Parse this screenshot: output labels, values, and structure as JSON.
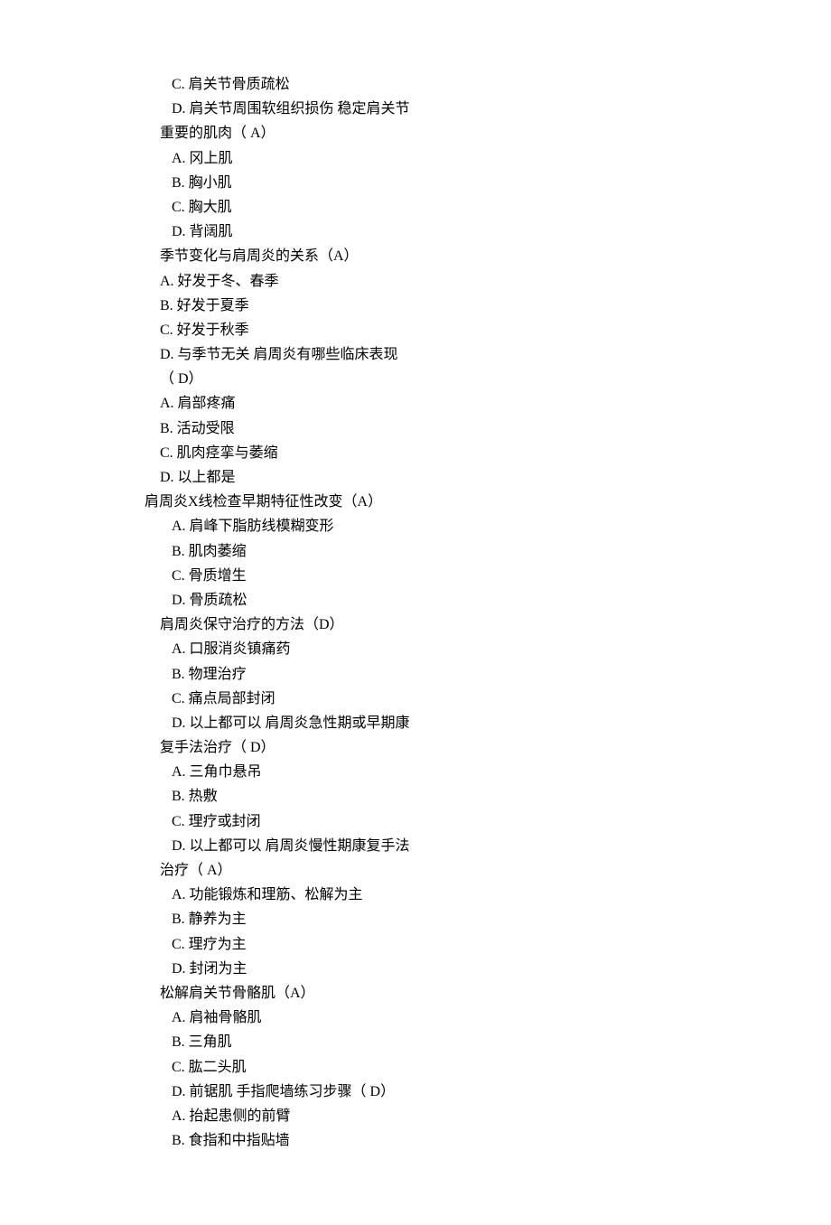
{
  "lines": [
    {
      "text": "C.  肩关节骨质疏松",
      "indent": "d4"
    },
    {
      "text": "D.  肩关节周围软组织损伤  稳定肩关节",
      "indent": "d4"
    },
    {
      "text": "重要的肌肉（ A）",
      "indent": "stem"
    },
    {
      "text": "A.  冈上肌",
      "indent": "d4"
    },
    {
      "text": "B.  胸小肌",
      "indent": "d4"
    },
    {
      "text": "C.  胸大肌",
      "indent": "d4"
    },
    {
      "text": "D.  背阔肌",
      "indent": "d4"
    },
    {
      "text": "季节变化与肩周炎的关系（A）",
      "indent": "stem"
    },
    {
      "text": "A.  好发于冬、春季",
      "indent": "opt"
    },
    {
      "text": "B.  好发于夏季",
      "indent": "opt"
    },
    {
      "text": "C.  好发于秋季",
      "indent": "opt"
    },
    {
      "text": "D.  与季节无关  肩周炎有哪些临床表现",
      "indent": "opt"
    },
    {
      "text": "（ D）",
      "indent": "stem"
    },
    {
      "text": "A.  肩部疼痛",
      "indent": "opt"
    },
    {
      "text": "B.  活动受限",
      "indent": "opt"
    },
    {
      "text": "C.  肌肉痉挛与萎缩",
      "indent": "opt"
    },
    {
      "text": "D.  以上都是",
      "indent": "opt"
    },
    {
      "text": "肩周炎X线检查早期特征性改变（A）",
      "indent": "stemL"
    },
    {
      "text": "A.  肩峰下脂肪线模糊变形",
      "indent": "d4"
    },
    {
      "text": "B.  肌肉萎缩",
      "indent": "d4"
    },
    {
      "text": "C.  骨质增生",
      "indent": "d4"
    },
    {
      "text": "D.  骨质疏松",
      "indent": "d4"
    },
    {
      "text": "肩周炎保守治疗的方法（D）",
      "indent": "stem"
    },
    {
      "text": "A.  口服消炎镇痛药",
      "indent": "d4"
    },
    {
      "text": "B.  物理治疗",
      "indent": "d4"
    },
    {
      "text": "C.  痛点局部封闭",
      "indent": "d4"
    },
    {
      "text": "D.  以上都可以  肩周炎急性期或早期康",
      "indent": "d4"
    },
    {
      "text": "复手法治疗（ D）",
      "indent": "stem"
    },
    {
      "text": "A.  三角巾悬吊",
      "indent": "d4"
    },
    {
      "text": "B.  热敷",
      "indent": "d4"
    },
    {
      "text": "C.  理疗或封闭",
      "indent": "d4"
    },
    {
      "text": "D.  以上都可以  肩周炎慢性期康复手法",
      "indent": "d4"
    },
    {
      "text": "治疗（ A）",
      "indent": "stem"
    },
    {
      "text": "A.  功能锻炼和理筋、松解为主",
      "indent": "d4"
    },
    {
      "text": "B.  静养为主",
      "indent": "d4"
    },
    {
      "text": "C.  理疗为主",
      "indent": "d4"
    },
    {
      "text": "D.  封闭为主",
      "indent": "d4"
    },
    {
      "text": "松解肩关节骨骼肌（A）",
      "indent": "stem"
    },
    {
      "text": "A.  肩袖骨骼肌",
      "indent": "d4"
    },
    {
      "text": "B.  三角肌",
      "indent": "d4"
    },
    {
      "text": "C.  肱二头肌",
      "indent": "d4"
    },
    {
      "text": "D.  前锯肌  手指爬墙练习步骤（ D）",
      "indent": "d4"
    },
    {
      "text": "A.  抬起患侧的前臂",
      "indent": "d4"
    },
    {
      "text": "B.  食指和中指贴墙",
      "indent": "d4"
    }
  ]
}
